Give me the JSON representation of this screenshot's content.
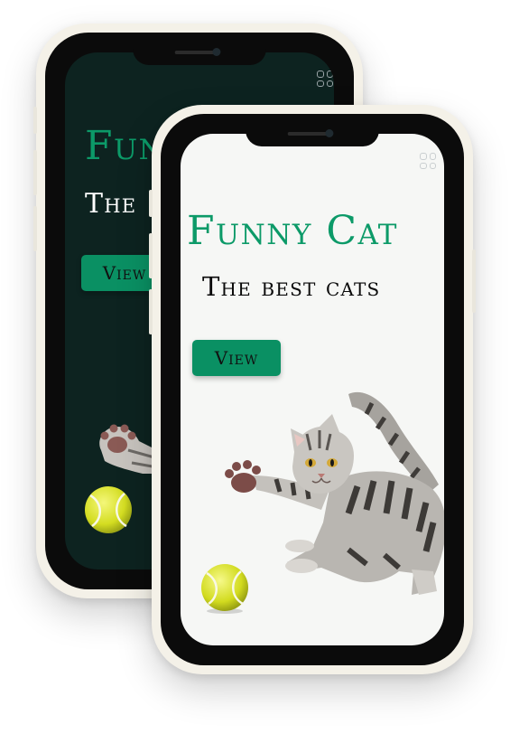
{
  "app": {
    "title": "Funny Cat",
    "subtitle": "The best cats",
    "view_button_label": "View"
  },
  "back_phone": {
    "title_visible": "Funn",
    "subtitle_visible": "The",
    "view_button_label": "View",
    "theme": "dark"
  },
  "colors": {
    "accent": "#0c9a68",
    "button": "#0a9063",
    "dark_screen": "#0d2320",
    "light_screen": "#f6f7f5",
    "frame": "#f4f1e8"
  },
  "icons": [
    "grid-menu-icon",
    "cat-illustration",
    "tennis-ball-icon"
  ]
}
